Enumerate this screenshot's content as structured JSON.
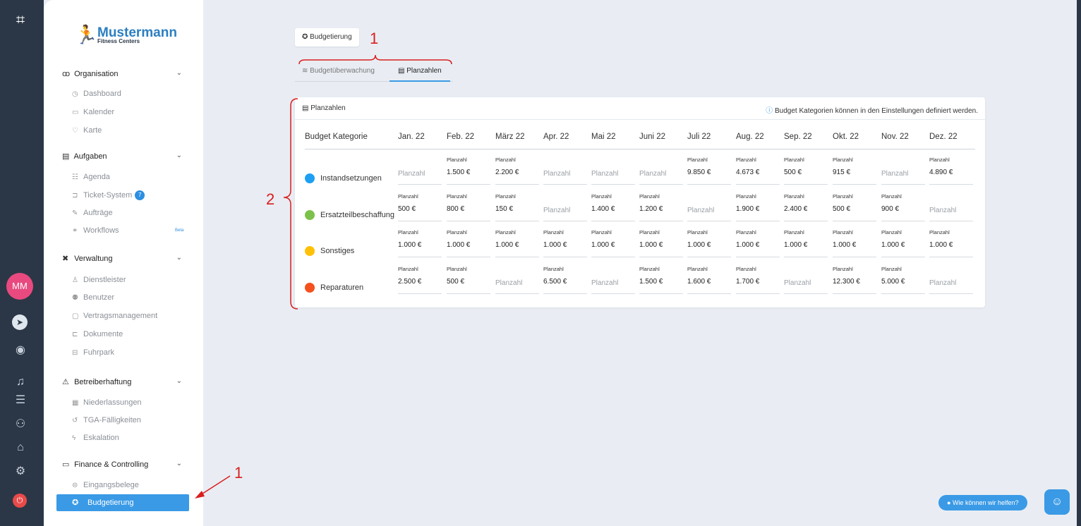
{
  "brand": {
    "name": "Mustermann",
    "sub": "Fitness Centers"
  },
  "rail": {
    "avatar": "MM"
  },
  "sidebar": {
    "sections": [
      {
        "label": "Organisation",
        "items": [
          "Dashboard",
          "Kalender",
          "Karte"
        ]
      },
      {
        "label": "Aufgaben",
        "items": [
          "Agenda",
          "Ticket-System",
          "Aufträge",
          "Workflows"
        ]
      },
      {
        "label": "Verwaltung",
        "items": [
          "Dienstleister",
          "Benutzer",
          "Vertragsmanagement",
          "Dokumente",
          "Fuhrpark"
        ]
      },
      {
        "label": "Betreiberhaftung",
        "items": [
          "Niederlassungen",
          "TGA-Fälligkeiten",
          "Eskalation"
        ]
      },
      {
        "label": "Finance & Controlling",
        "items": [
          "Eingangsbelege",
          "Budgetierung"
        ]
      }
    ],
    "ticket_badge": "7",
    "workflows_beta": "Beta"
  },
  "main": {
    "budget_button": "Budgetierung",
    "tabs": [
      "Budgetüberwachung",
      "Planzahlen"
    ],
    "card_title": "Planzahlen",
    "card_info": "Budget Kategorien können in den Einstellungen definiert werden."
  },
  "table": {
    "category_header": "Budget Kategorie",
    "months": [
      "Jan. 22",
      "Feb. 22",
      "März 22",
      "Apr. 22",
      "Mai 22",
      "Juni 22",
      "Juli 22",
      "Aug. 22",
      "Sep. 22",
      "Okt. 22",
      "Nov. 22",
      "Dez. 22"
    ],
    "label": "Planzahl",
    "placeholder": "Planzahl",
    "rows": [
      {
        "name": "Instandsetzungen",
        "color": "#1e9ff2",
        "values": [
          "",
          "1.500 €",
          "2.200 €",
          "",
          "",
          "",
          "9.850 €",
          "4.673 €",
          "500 €",
          "915 €",
          "",
          "4.890 €"
        ]
      },
      {
        "name": "Ersatzteilbeschaffung",
        "color": "#7cc24a",
        "values": [
          "500 €",
          "800 €",
          "150 €",
          "",
          "1.400 €",
          "1.200 €",
          "",
          "1.900 €",
          "2.400 €",
          "500 €",
          "900 €",
          ""
        ]
      },
      {
        "name": "Sonstiges",
        "color": "#ffc107",
        "values": [
          "1.000 €",
          "1.000 €",
          "1.000 €",
          "1.000 €",
          "1.000 €",
          "1.000 €",
          "1.000 €",
          "1.000 €",
          "1.000 €",
          "1.000 €",
          "1.000 €",
          "1.000 €"
        ]
      },
      {
        "name": "Reparaturen",
        "color": "#f4511e",
        "values": [
          "2.500 €",
          "500 €",
          "",
          "6.500 €",
          "",
          "1.500 €",
          "1.600 €",
          "1.700 €",
          "",
          "12.300 €",
          "5.000 €",
          ""
        ]
      }
    ]
  },
  "annotations": {
    "a1": "1",
    "a2": "2",
    "a3": "1"
  },
  "help": {
    "button": "Wie können wir helfen?"
  }
}
